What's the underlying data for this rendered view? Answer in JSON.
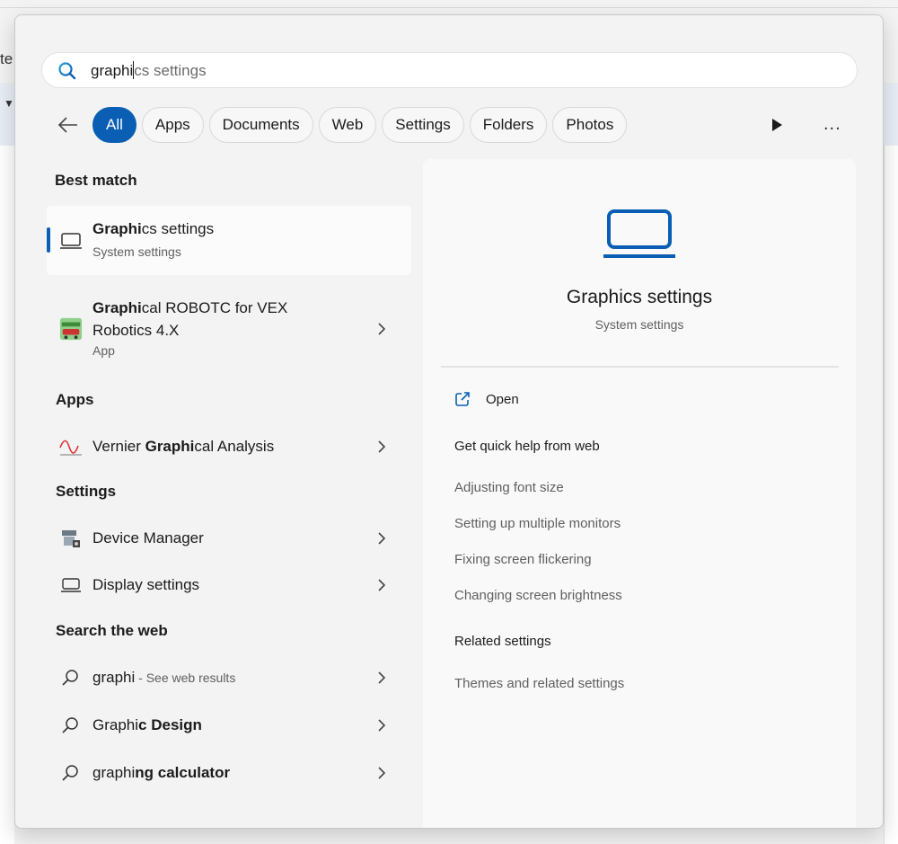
{
  "background": {
    "fragment_text": "te"
  },
  "search": {
    "typed": "graphi",
    "completion": "cs settings"
  },
  "filters": {
    "back_label": "Back",
    "chips": [
      "All",
      "Apps",
      "Documents",
      "Web",
      "Settings",
      "Folders",
      "Photos"
    ],
    "active": "All",
    "more_label": "..."
  },
  "results": {
    "best_match_title": "Best match",
    "best_match": {
      "bold": "Graphi",
      "rest": "cs settings",
      "sub": "System settings",
      "icon": "laptop-icon"
    },
    "second_match": {
      "bold": "Graphi",
      "rest_line1": "cal ROBOTC for VEX",
      "line2": "Robotics 4.X",
      "sub": "App",
      "icon": "robotc-app-icon"
    },
    "apps_title": "Apps",
    "apps": [
      {
        "pre": "Vernier ",
        "bold": "Graphi",
        "rest": "cal Analysis",
        "icon": "vernier-graph-icon"
      }
    ],
    "settings_title": "Settings",
    "settings": [
      {
        "label": "Device Manager",
        "icon": "device-manager-icon"
      },
      {
        "label": "Display settings",
        "icon": "laptop-icon"
      }
    ],
    "web_title": "Search the web",
    "web": [
      {
        "normal": "graphi",
        "bold": "",
        "suffix": " - See web results"
      },
      {
        "normal": "Graphi",
        "bold": "c Design",
        "suffix": ""
      },
      {
        "normal": "graphi",
        "bold": "ng calculator",
        "suffix": ""
      }
    ]
  },
  "preview": {
    "title": "Graphics settings",
    "subtitle": "System settings",
    "open_label": "Open",
    "quick_help_title": "Get quick help from web",
    "quick_help": [
      "Adjusting font size",
      "Setting up multiple monitors",
      "Fixing screen flickering",
      "Changing screen brightness"
    ],
    "related_title": "Related settings",
    "related": [
      "Themes and related settings"
    ]
  },
  "colors": {
    "accent": "#0a5fb4",
    "panel_bg": "#f3f3f3",
    "preview_bg": "#f9f9f9"
  }
}
